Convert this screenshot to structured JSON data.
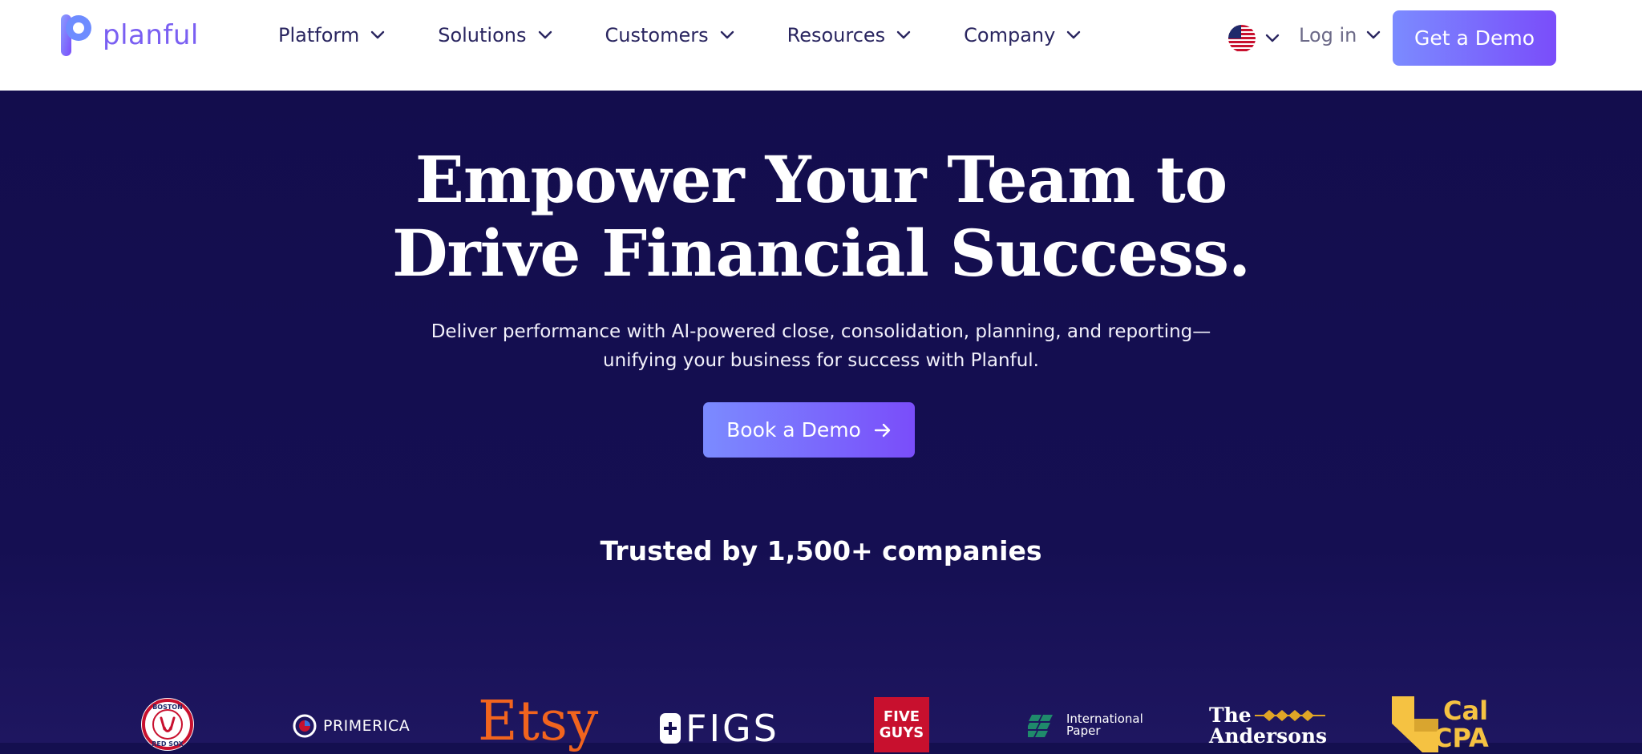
{
  "brand": {
    "name": "planful",
    "accent": "#7a5ff2"
  },
  "nav": {
    "items": [
      {
        "label": "Platform"
      },
      {
        "label": "Solutions"
      },
      {
        "label": "Customers"
      },
      {
        "label": "Resources"
      },
      {
        "label": "Company"
      }
    ]
  },
  "header_tools": {
    "locale_icon": "us-flag-icon",
    "login_label": "Log in",
    "demo_label": "Get a Demo"
  },
  "hero": {
    "headline_line1": "Empower Your Team to",
    "headline_line2": "Drive Financial Success.",
    "subhead_line1": "Deliver performance with AI-powered close, consolidation, planning, and reporting—",
    "subhead_line2": "unifying your business for success with Planful.",
    "cta_label": "Book a Demo",
    "trusted_label": "Trusted by 1,500+ companies"
  },
  "logos": {
    "primerica": "PRIMERICA",
    "etsy": "Etsy",
    "figs": "FIGS",
    "fiveguys_1": "FIVE",
    "fiveguys_2": "GUYS",
    "ip_1": "International",
    "ip_2": "Paper",
    "andersons_1": "The",
    "andersons_2": "Andersons",
    "calcpa_1": "Cal",
    "calcpa_2": "CPA",
    "boston_1": "BOSTON",
    "boston_2": "RED SOX"
  },
  "colors": {
    "hero_bg": "#140f4f",
    "button_gradient_start": "#7b8bff",
    "button_gradient_end": "#7a4dfa",
    "nav_text": "#2a2660",
    "etsy_orange": "#f1641e",
    "five_guys_red": "#c8102e",
    "cal_cpa_yellow": "#f5c242"
  }
}
